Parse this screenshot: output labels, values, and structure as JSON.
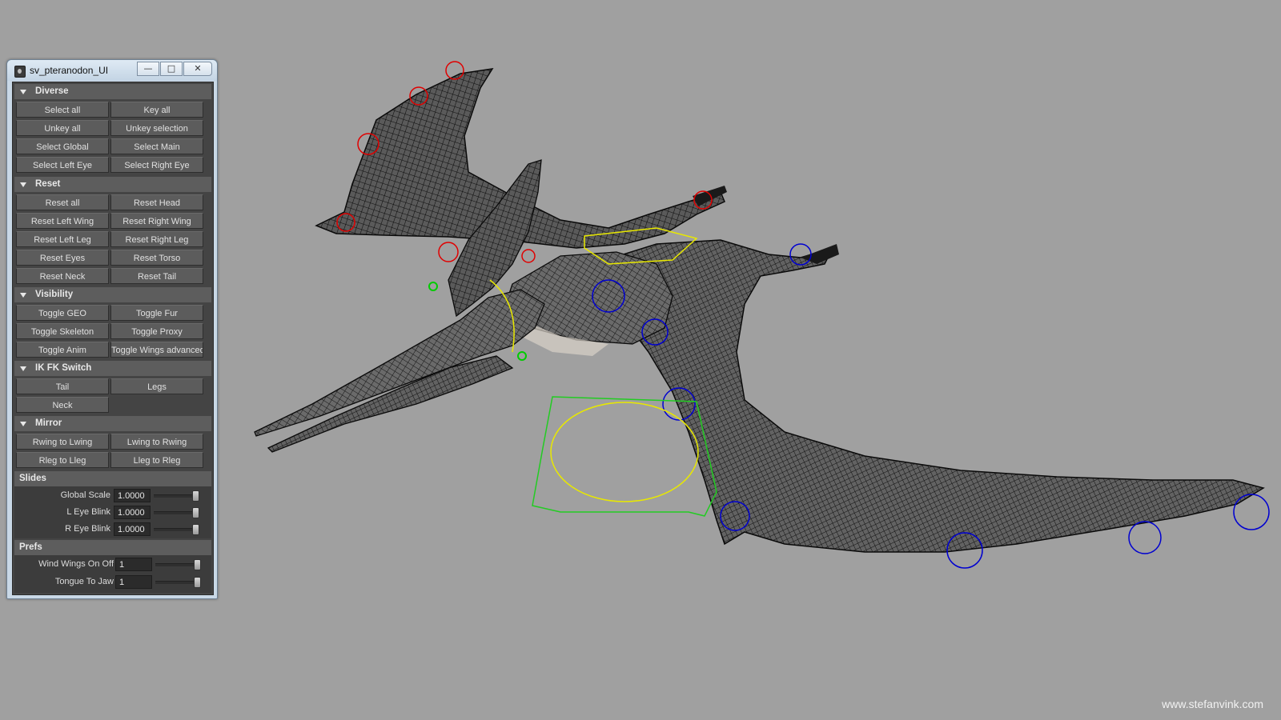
{
  "window": {
    "title": "sv_pteranodon_UI",
    "controls": {
      "minimize": "—",
      "maximize": "□",
      "close": "✕"
    }
  },
  "sections": {
    "diverse": {
      "title": "Diverse",
      "buttons": [
        "Select all",
        "Key all",
        "Unkey all",
        "Unkey selection",
        "Select Global",
        "Select Main",
        "Select Left Eye",
        "Select Right Eye"
      ]
    },
    "reset": {
      "title": "Reset",
      "buttons": [
        "Reset all",
        "Reset Head",
        "Reset Left Wing",
        "Reset Right Wing",
        "Reset Left Leg",
        "Reset Right Leg",
        "Reset Eyes",
        "Reset Torso",
        "Reset Neck",
        "Reset Tail"
      ]
    },
    "visibility": {
      "title": "Visibility",
      "buttons": [
        "Toggle GEO",
        "Toggle Fur",
        "Toggle Skeleton",
        "Toggle Proxy",
        "Toggle Anim",
        "Toggle Wings advanced"
      ]
    },
    "ikfk": {
      "title": "IK FK Switch",
      "buttons": [
        "Tail",
        "Legs",
        "Neck"
      ]
    },
    "mirror": {
      "title": "Mirror",
      "buttons": [
        "Rwing to Lwing",
        "Lwing to Rwing",
        "Rleg to Lleg",
        "Lleg to Rleg"
      ]
    },
    "slides": {
      "title": "Slides",
      "rows": [
        {
          "label": "Global Scale",
          "value": "1.0000",
          "level": 1.0
        },
        {
          "label": "L Eye Blink",
          "value": "1.0000",
          "level": 1.0
        },
        {
          "label": "R Eye Blink",
          "value": "1.0000",
          "level": 1.0
        }
      ]
    },
    "prefs": {
      "title": "Prefs",
      "rows": [
        {
          "label": "Wind Wings On Off",
          "value": "1",
          "level": 1.0
        },
        {
          "label": "Tongue To Jaw",
          "value": "1",
          "level": 1.0
        }
      ]
    }
  },
  "viewport": {
    "subject": "pteranodon-wireframe",
    "background": "#a0a0a0"
  },
  "watermark": "www.stefanvink.com"
}
